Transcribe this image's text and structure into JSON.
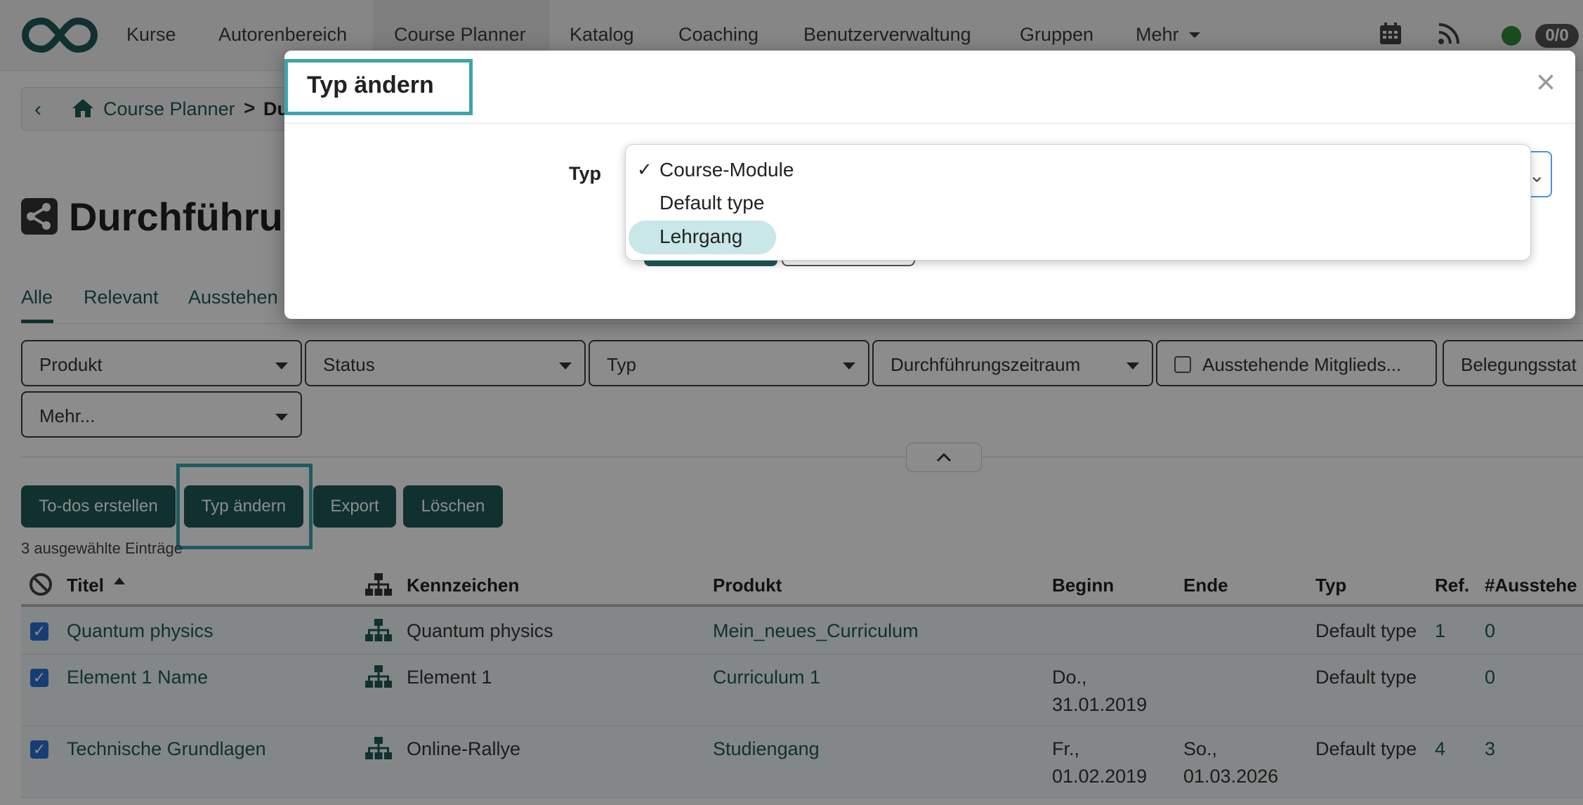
{
  "nav": {
    "items": [
      "Kurse",
      "Autorenbereich",
      "Course Planner",
      "Katalog",
      "Coaching",
      "Benutzerverwaltung",
      "Gruppen",
      "Mehr"
    ],
    "count_badge": "0/0",
    "icons": [
      "logo-infinity",
      "calendar-icon",
      "rss-icon",
      "status-dot"
    ]
  },
  "breadcrumb": {
    "link": "Course Planner",
    "separator": ">",
    "current": "Du"
  },
  "page": {
    "title": "Durchführur"
  },
  "tabs": [
    "Alle",
    "Relevant",
    "Ausstehen"
  ],
  "filters": {
    "items": [
      "Produkt",
      "Status",
      "Typ",
      "Durchführungszeitraum",
      "Ausstehende Mitglieds...",
      "Belegungsstat",
      "Mehr..."
    ]
  },
  "actions": {
    "buttons": [
      "To-dos erstellen",
      "Typ ändern",
      "Export",
      "Löschen"
    ],
    "selected_count": "3 ausgewählte Einträge"
  },
  "table": {
    "headers": [
      "Titel",
      "Kennzeichen",
      "Produkt",
      "Beginn",
      "Ende",
      "Typ",
      "Ref.",
      "#Ausstehe"
    ],
    "rows": [
      {
        "title": "Quantum physics",
        "kennzeichen": "Quantum physics",
        "produkt": "Mein_neues_Curriculum",
        "beginn_1": "",
        "beginn_2": "",
        "ende_1": "",
        "ende_2": "",
        "typ": "Default type",
        "ref": "1",
        "ausstehend": "0"
      },
      {
        "title": "Element 1 Name",
        "kennzeichen": "Element 1",
        "produkt": "Curriculum 1",
        "beginn_1": "Do.,",
        "beginn_2": "31.01.2019",
        "ende_1": "",
        "ende_2": "",
        "typ": "Default type",
        "ref": "",
        "ausstehend": "0"
      },
      {
        "title": "Technische Grundlagen",
        "kennzeichen": "Online-Rallye",
        "produkt": "Studiengang",
        "beginn_1": "Fr.,",
        "beginn_2": "01.02.2019",
        "ende_1": "So.,",
        "ende_2": "01.03.2026",
        "typ": "Default type",
        "ref": "4",
        "ausstehend": "3"
      }
    ]
  },
  "modal": {
    "title": "Typ ändern",
    "close": "×",
    "field_label": "Typ",
    "options": [
      "Course-Module",
      "Default type",
      "Lehrgang"
    ],
    "selected_option": "Course-Module",
    "check_mark": "✓",
    "highlighted_option": "Lehrgang"
  },
  "colors": {
    "brand": "#1e5a58",
    "highlight_frame": "#3aa6ad",
    "checkbox": "#2a6fd6",
    "status_online": "#2e8b3a"
  }
}
